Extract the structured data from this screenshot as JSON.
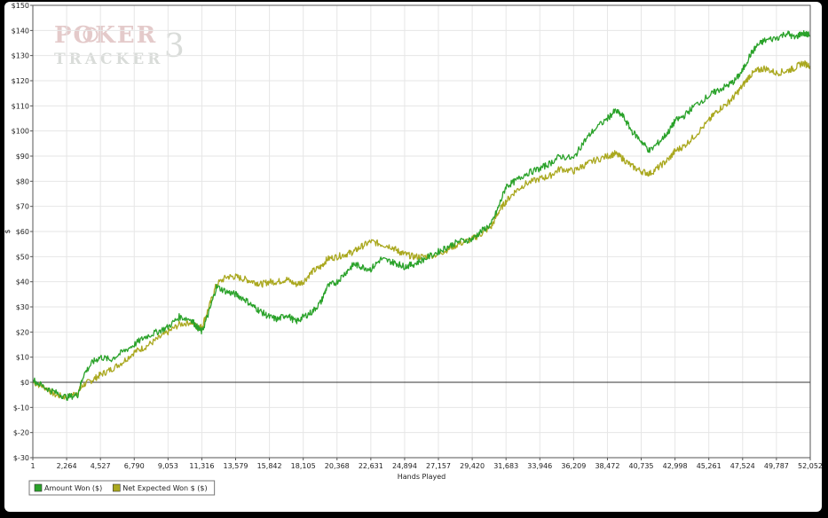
{
  "watermark": {
    "line1": "POKER",
    "line2": "TRACKER",
    "mark": "3"
  },
  "chart_data": {
    "type": "line",
    "xlabel": "Hands Played",
    "ylabel": "$",
    "xlim": [
      1,
      52052
    ],
    "ylim": [
      -30,
      150
    ],
    "yticks": [
      -30,
      -20,
      -10,
      0,
      10,
      20,
      30,
      40,
      50,
      60,
      70,
      80,
      90,
      100,
      110,
      120,
      130,
      140,
      150
    ],
    "ytick_labels": [
      "$-30",
      "$-20",
      "$-10",
      "$0",
      "$10",
      "$20",
      "$30",
      "$40",
      "$50",
      "$60",
      "$70",
      "$80",
      "$90",
      "$100",
      "$110",
      "$120",
      "$130",
      "$140",
      "$150"
    ],
    "xticks": [
      1,
      2264,
      4527,
      6790,
      9053,
      11316,
      13579,
      15842,
      18105,
      20368,
      22631,
      24894,
      27157,
      29420,
      31683,
      33946,
      36209,
      38472,
      40735,
      42998,
      45261,
      47524,
      49787,
      52052
    ],
    "xtick_labels": [
      "1",
      "2,264",
      "4,527",
      "6,790",
      "9,053",
      "11,316",
      "13,579",
      "15,842",
      "18,105",
      "20,368",
      "22,631",
      "24,894",
      "27,157",
      "29,420",
      "31,683",
      "33,946",
      "36,209",
      "38,472",
      "40,735",
      "42,998",
      "45,261",
      "47,524",
      "49,787",
      "52,052"
    ],
    "grid": true,
    "legend_position": "bottom-left",
    "series": [
      {
        "name": "Amount Won ($)",
        "color": "#2aa22a",
        "x": [
          1,
          800,
          1500,
          2264,
          3000,
          3400,
          4000,
          4527,
          5200,
          6000,
          6790,
          7500,
          8300,
          9053,
          9800,
          10600,
          11000,
          11316,
          11800,
          12300,
          13000,
          13579,
          14200,
          14800,
          15300,
          15842,
          16400,
          17000,
          17600,
          18105,
          18700,
          19300,
          19700,
          20368,
          21000,
          21500,
          22000,
          22631,
          23300,
          24000,
          24500,
          24894,
          25500,
          26200,
          27157,
          27800,
          28500,
          29420,
          30000,
          30700,
          31200,
          31683,
          32300,
          33000,
          33946,
          34600,
          35300,
          36209,
          36800,
          37500,
          38472,
          39000,
          39500,
          40100,
          40735,
          41300,
          42000,
          42600,
          42998,
          43600,
          44300,
          45261,
          45800,
          46500,
          47000,
          47524,
          48000,
          48500,
          49000,
          49787,
          50500,
          51000,
          51500,
          52052
        ],
        "y": [
          1,
          -2,
          -4,
          -6,
          -5,
          3,
          8,
          10,
          9,
          12,
          15,
          18,
          20,
          22,
          26,
          25,
          22,
          20,
          28,
          38,
          36,
          35,
          33,
          30,
          28,
          26,
          25,
          27,
          24,
          26,
          28,
          32,
          38,
          40,
          44,
          47,
          46,
          45,
          49,
          48,
          47,
          46,
          47,
          49,
          52,
          54,
          56,
          57,
          60,
          63,
          70,
          78,
          80,
          83,
          85,
          87,
          90,
          89,
          95,
          100,
          105,
          108,
          106,
          100,
          96,
          92,
          96,
          100,
          104,
          106,
          110,
          114,
          116,
          118,
          120,
          124,
          130,
          134,
          136,
          137,
          139,
          137,
          139,
          138
        ]
      },
      {
        "name": "Net Expected Won $ ($)",
        "color": "#aaa81f",
        "x": [
          1,
          800,
          1500,
          2264,
          3000,
          3400,
          4000,
          4527,
          5200,
          6000,
          6790,
          7500,
          8300,
          9053,
          9800,
          10600,
          11000,
          11316,
          11800,
          12300,
          13000,
          13579,
          14200,
          14800,
          15300,
          15842,
          16400,
          17000,
          17600,
          18105,
          18700,
          19300,
          19700,
          20368,
          21000,
          21500,
          22000,
          22631,
          23300,
          24000,
          24500,
          24894,
          25500,
          26200,
          27157,
          27800,
          28500,
          29420,
          30000,
          30700,
          31200,
          31683,
          32300,
          33000,
          33946,
          34600,
          35300,
          36209,
          36800,
          37500,
          38472,
          39000,
          39500,
          40100,
          40735,
          41300,
          42000,
          42600,
          42998,
          43600,
          44300,
          45261,
          45800,
          46500,
          47000,
          47524,
          48000,
          48500,
          49000,
          49787,
          50500,
          51000,
          51500,
          52052
        ],
        "y": [
          0,
          -2,
          -5,
          -6,
          -4,
          -1,
          1,
          3,
          5,
          8,
          12,
          14,
          17,
          20,
          23,
          24,
          22,
          22,
          30,
          39,
          42,
          42,
          41,
          40,
          39,
          40,
          40,
          41,
          39,
          40,
          44,
          46,
          49,
          50,
          51,
          52,
          54,
          56,
          55,
          54,
          52,
          51,
          50,
          50,
          51,
          53,
          55,
          57,
          59,
          62,
          68,
          72,
          76,
          79,
          81,
          82,
          85,
          84,
          86,
          88,
          90,
          91,
          89,
          86,
          84,
          83,
          86,
          89,
          92,
          94,
          98,
          104,
          108,
          111,
          114,
          118,
          122,
          124,
          125,
          123,
          124,
          125,
          127,
          126
        ]
      }
    ]
  }
}
